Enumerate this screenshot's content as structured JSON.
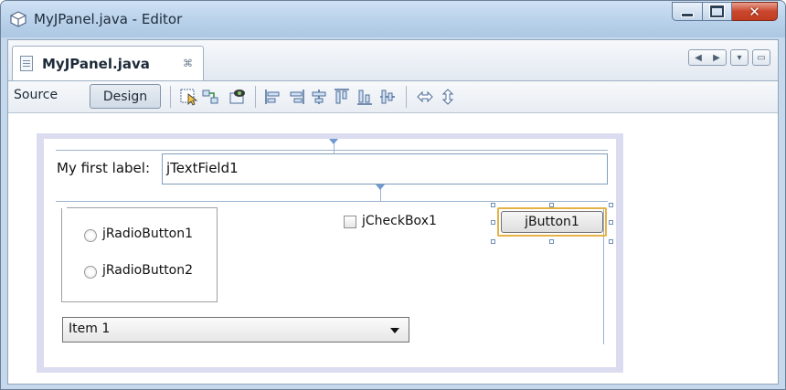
{
  "window": {
    "title": "MyJPanel.java - Editor"
  },
  "tabs": [
    {
      "label": "MyJPanel.java",
      "close_glyph": "⌘"
    }
  ],
  "toolbar": {
    "source_label": "Source",
    "design_label": "Design"
  },
  "form": {
    "label_text": "My first label:",
    "text_field_value": "jTextField1",
    "radio_buttons": [
      {
        "label": "jRadioButton1"
      },
      {
        "label": "jRadioButton2"
      }
    ],
    "checkbox_label": "jCheckBox1",
    "button_label": "jButton1",
    "combo_selected": "Item 1"
  },
  "colors": {
    "titlebar": "#c6d9ec",
    "selection": "#e6b145",
    "guides": "#9bb3d0",
    "canvas_bg": "#dcdcf0"
  }
}
